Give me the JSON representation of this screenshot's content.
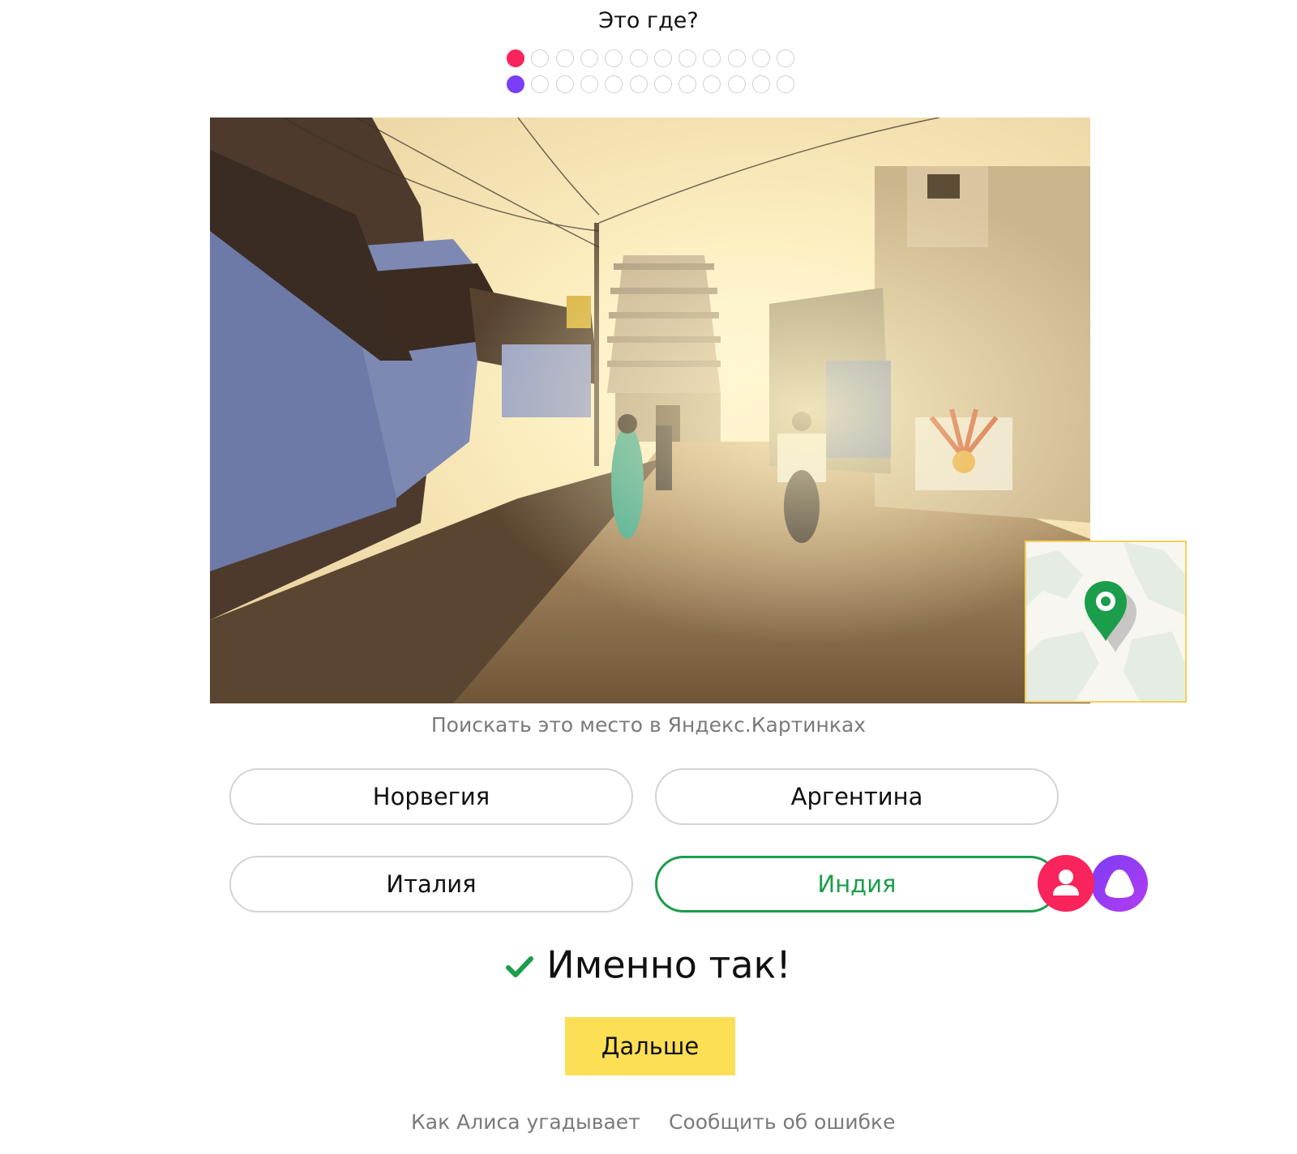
{
  "header": {
    "title": "Это где?"
  },
  "progress": {
    "total": 12,
    "user_answered": 1,
    "alice_answered": 1,
    "user_color": "#f9245b",
    "alice_color": "#7b3cf6"
  },
  "photo": {
    "scene": "street-with-temple-tower-at-sunset"
  },
  "minimap": {
    "icon": "map-pin-icon",
    "pin_color": "#1c9d4b"
  },
  "search_link": "Поискать это место в Яндекс.Картинках",
  "answers": [
    {
      "label": "Норвегия",
      "state": "default"
    },
    {
      "label": "Аргентина",
      "state": "default"
    },
    {
      "label": "Италия",
      "state": "default"
    },
    {
      "label": "Индия",
      "state": "correct"
    }
  ],
  "badges": {
    "user": {
      "icon": "user-icon",
      "color": "#f9245b"
    },
    "alice": {
      "icon": "alice-icon",
      "color": "#8b3cf6"
    }
  },
  "result": {
    "icon": "checkmark-icon",
    "text": "Именно так!",
    "color": "#1c9d4b"
  },
  "next_button": {
    "label": "Дальше",
    "color": "#fddf56"
  },
  "footer": {
    "how_alice_guesses": "Как Алиса угадывает",
    "report_error": "Сообщить об ошибке"
  }
}
